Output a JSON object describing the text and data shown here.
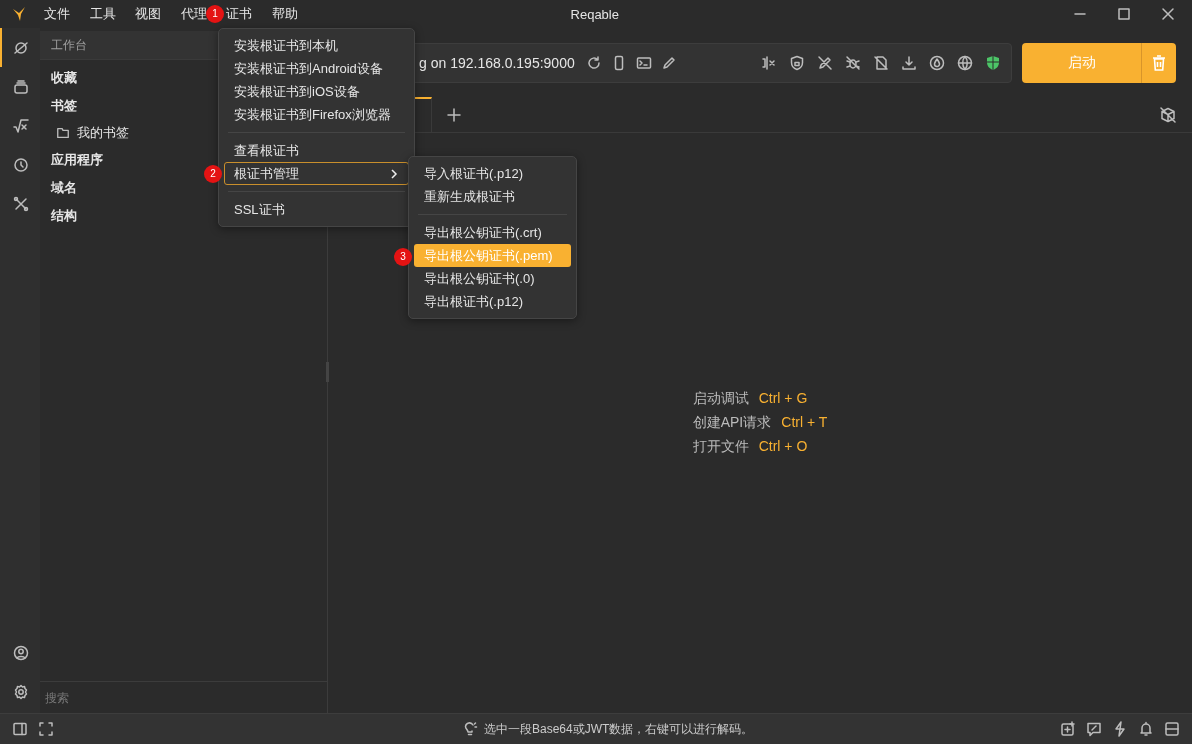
{
  "window": {
    "title": "Reqable"
  },
  "menubar": [
    {
      "label": "文件"
    },
    {
      "label": "工具"
    },
    {
      "label": "视图"
    },
    {
      "label": "代理"
    },
    {
      "label": "证书"
    },
    {
      "label": "帮助"
    }
  ],
  "rail": [
    {
      "selected": true
    },
    {
      "selected": false
    },
    {
      "selected": false
    },
    {
      "selected": false
    },
    {
      "selected": false
    }
  ],
  "sidebar": {
    "header": "工作台",
    "items": [
      {
        "label": "收藏"
      },
      {
        "label": "书签",
        "children": [
          {
            "label": "我的书签"
          }
        ]
      },
      {
        "label": "应用程序"
      },
      {
        "label": "域名"
      },
      {
        "label": "结构"
      }
    ],
    "search": {
      "placeholder": "搜索"
    }
  },
  "toolbar": {
    "address": "g on 192.168.0.195:9000",
    "start_button": "启动"
  },
  "tabs": [
    {
      "selected": true
    }
  ],
  "hints": [
    {
      "action": "启动调试",
      "shortcut": "Ctrl + G"
    },
    {
      "action": "创建API请求",
      "shortcut": "Ctrl + T"
    },
    {
      "action": "打开文件",
      "shortcut": "Ctrl + O"
    }
  ],
  "status_bar": {
    "message": "选中一段Base64或JWT数据，右键可以进行解码。"
  },
  "cert_menu": [
    {
      "kind": "item",
      "label": "安装根证书到本机",
      "selected": false
    },
    {
      "kind": "item",
      "label": "安装根证书到Android设备",
      "selected": false
    },
    {
      "kind": "item",
      "label": "安装根证书到iOS设备",
      "selected": false
    },
    {
      "kind": "item",
      "label": "安装根证书到Firefox浏览器",
      "selected": false
    },
    {
      "kind": "separator"
    },
    {
      "kind": "item",
      "label": "查看根证书",
      "selected": false
    },
    {
      "kind": "submenu",
      "label": "根证书管理",
      "selected": true
    },
    {
      "kind": "separator"
    },
    {
      "kind": "item",
      "label": "SSL证书",
      "selected": false
    }
  ],
  "submenu": [
    {
      "kind": "item",
      "label": "导入根证书(.p12)",
      "selected": false
    },
    {
      "kind": "item",
      "label": "重新生成根证书",
      "selected": false
    },
    {
      "kind": "separator"
    },
    {
      "kind": "item",
      "label": "导出根公钥证书(.crt)",
      "selected": false
    },
    {
      "kind": "item",
      "label": "导出根公钥证书(.pem)",
      "selected": true
    },
    {
      "kind": "item",
      "label": "导出根公钥证书(.0)",
      "selected": false
    },
    {
      "kind": "item",
      "label": "导出根证书(.p12)",
      "selected": false
    }
  ],
  "step_badges": [
    "1",
    "2",
    "3"
  ]
}
